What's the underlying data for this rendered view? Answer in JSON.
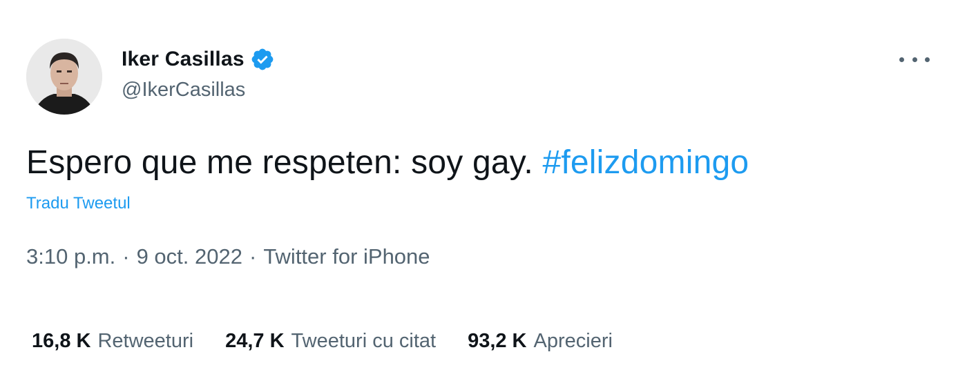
{
  "author": {
    "display_name": "Iker Casillas",
    "handle": "@IkerCasillas",
    "verified": true,
    "avatar_icon": "user-avatar",
    "verified_icon": "verified-badge-icon",
    "verified_color": "#1d9bf0"
  },
  "menu": {
    "icon": "more-horizontal-icon"
  },
  "tweet": {
    "text": "Espero que me respeten: soy gay.",
    "hashtag": "#felizdomingo",
    "translate_label": "Tradu Tweetul"
  },
  "meta": {
    "time": "3:10 p.m.",
    "date": "9 oct. 2022",
    "source": "Twitter for iPhone",
    "separator": "·"
  },
  "stats": [
    {
      "count": "16,8 K",
      "label": "Retweeturi"
    },
    {
      "count": "24,7 K",
      "label": "Tweeturi cu citat"
    },
    {
      "count": "93,2 K",
      "label": "Aprecieri"
    }
  ],
  "colors": {
    "link": "#1d9bf0",
    "primary_text": "#0f1419",
    "secondary_text": "#536471"
  }
}
